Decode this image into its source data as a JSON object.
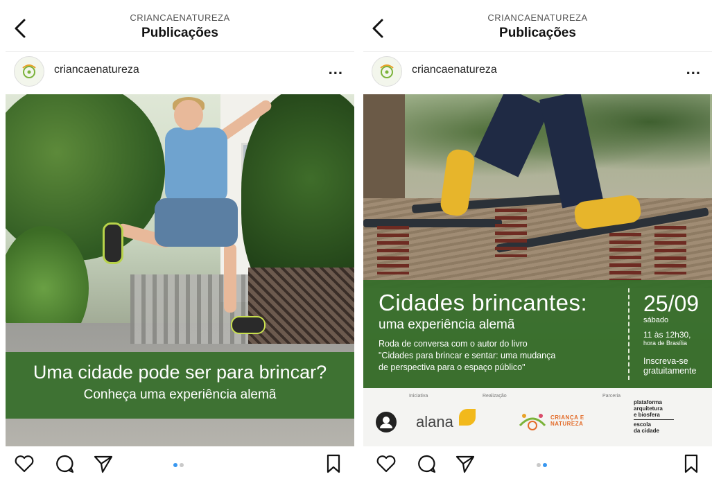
{
  "colors": {
    "banner_green": "#366e2a",
    "carousel_active": "#3897f0",
    "carousel_inactive": "#c9c9c9"
  },
  "icons": {
    "back": "chevron-left-icon",
    "more": "more-horizontal-icon",
    "like": "heart-icon",
    "comment": "comment-icon",
    "share": "send-icon",
    "save": "bookmark-icon"
  },
  "panels": [
    {
      "header": {
        "account_caps": "CRIANCAENATUREZA",
        "title": "Publicações"
      },
      "post": {
        "username": "criancaenatureza",
        "more": "..."
      },
      "banner": {
        "headline": "Uma cidade pode ser para brincar?",
        "subline": "Conheça uma experiência alemã"
      },
      "carousel": {
        "total": 2,
        "active": 1
      }
    },
    {
      "header": {
        "account_caps": "CRIANCAENATUREZA",
        "title": "Publicações"
      },
      "post": {
        "username": "criancaenatureza",
        "more": "..."
      },
      "banner": {
        "title": "Cidades brincantes:",
        "subtitle": "uma experiência alemã",
        "desc_line1": "Roda de conversa com o autor do livro",
        "desc_line2": "\"Cidades para brincar e sentar: uma mudança",
        "desc_line3": "de perspectiva para o espaço público\"",
        "date": "25/09",
        "weekday": "sábado",
        "time": "11 às 12h30,",
        "timezone": "hora de Brasília",
        "cta_line1": "Inscreva-se",
        "cta_line2": "gratuitamente"
      },
      "logos": {
        "label_iniciativa": "Iniciativa",
        "label_realizacao": "Realização",
        "label_parceria": "Parceria",
        "alana": "alana",
        "cn_line1": "CRIANÇA E",
        "cn_line2": "NATUREZA",
        "partner1_line1": "plataforma",
        "partner1_line2": "arquitetura",
        "partner1_line3": "e biosfera",
        "partner2_line1": "escola",
        "partner2_line2": "da cidade"
      },
      "carousel": {
        "total": 2,
        "active": 2
      }
    }
  ]
}
